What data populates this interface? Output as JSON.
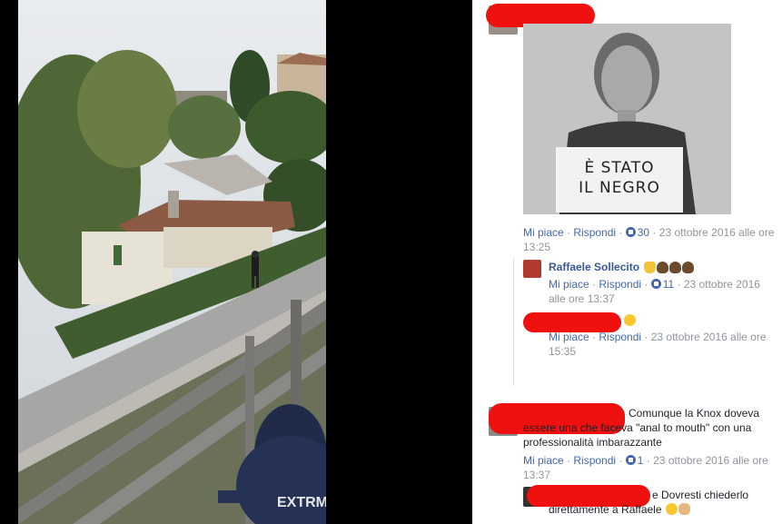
{
  "post_photo": {
    "sign_text_line1": "È STATO",
    "sign_text_line2": "IL NEGRO"
  },
  "comments": [
    {
      "author": "",
      "actions": {
        "like": "Mi piace",
        "reply": "Rispondi"
      },
      "reactions": "30",
      "timestamp": "23 ottobre 2016 alle ore 13:25"
    },
    {
      "author": "Raffaele Sollecito",
      "actions": {
        "like": "Mi piace",
        "reply": "Rispondi"
      },
      "reactions": "11",
      "timestamp": "23 ottobre 2016 alle ore 13:37"
    },
    {
      "author": "",
      "actions": {
        "like": "Mi piace",
        "reply": "Rispondi"
      },
      "timestamp": "23 ottobre 2016 alle ore 15:35"
    },
    {
      "author": "",
      "text_line1": "Comunque la Knox doveva",
      "text_line2": "essere una che faceva \"anal to mouth\" con una",
      "text_line3": "professionalità imbarazzante",
      "actions": {
        "like": "Mi piace",
        "reply": "Rispondi"
      },
      "reactions": "1",
      "timestamp": "23 ottobre 2016 alle ore 13:37"
    },
    {
      "author": "",
      "text_line1": "e Dovresti chiederlo",
      "text_line2": "direttamente a Raffaele"
    }
  ],
  "separator": " · ",
  "colors": {
    "redaction": "#ef1010",
    "link": "#4267b2",
    "meta": "#90949c"
  },
  "icons": [
    "like-icon",
    "clapping-hands-emoji",
    "poo-emoji",
    "laughing-emoji",
    "ok-hand-emoji",
    "print-icon"
  ]
}
